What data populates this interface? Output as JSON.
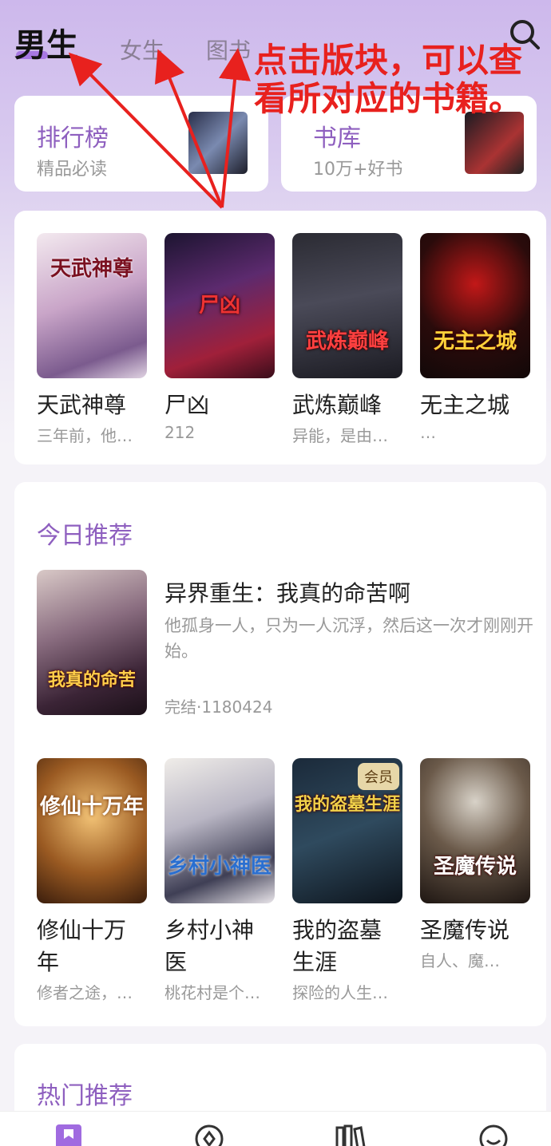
{
  "tabs": [
    {
      "label": "男生",
      "active": true
    },
    {
      "label": "女生",
      "active": false
    },
    {
      "label": "图书",
      "active": false
    }
  ],
  "annotation": "点击版块，可以查看所对应的书籍。",
  "rank_card": {
    "title": "排行榜",
    "subtitle": "精品必读"
  },
  "library_card": {
    "title": "书库",
    "subtitle": "10万+好书"
  },
  "top_books": [
    {
      "title": "天武神尊",
      "desc": "三年前，他…",
      "cover_text": "天武神尊"
    },
    {
      "title": "尸凶",
      "desc": "212",
      "cover_text": "尸凶"
    },
    {
      "title": "武炼巅峰",
      "desc": "异能，是由…",
      "cover_text": "武炼巅峰"
    },
    {
      "title": "无主之城",
      "desc": "…",
      "cover_text": "无主之城"
    }
  ],
  "today": {
    "section_title": "今日推荐",
    "featured": {
      "title": "异界重生：我真的命苦啊",
      "desc": "他孤身一人，只为一人沉浮，然后这一次才刚刚开始。",
      "meta": "完结·1180424",
      "cover_text": "我真的命苦"
    },
    "books": [
      {
        "title": "修仙十万年",
        "desc": "修者之途，…",
        "cover_text": "修仙十万年",
        "vip": ""
      },
      {
        "title": "乡村小神医",
        "desc": "桃花村是个…",
        "cover_text": "乡村小神医",
        "vip": ""
      },
      {
        "title": "我的盗墓生涯",
        "desc": "探险的人生…",
        "cover_text": "我的盗墓生涯",
        "vip": "会员"
      },
      {
        "title": "圣魔传说",
        "desc": "自人、魔…",
        "cover_text": "圣魔传说",
        "vip": ""
      }
    ]
  },
  "hot": {
    "section_title": "热门推荐"
  },
  "colors": {
    "accent": "#8e5fbf",
    "annotation": "#e8211e"
  }
}
